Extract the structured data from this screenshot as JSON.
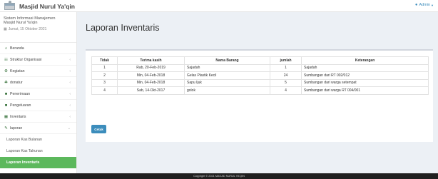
{
  "header": {
    "app_title": "Masjid Nurul Ya'qin",
    "user_label": "Admin",
    "logo_icon": "mosque-logo-icon"
  },
  "sidebar": {
    "system_name_line1": "Sistem Informasi Manajemen",
    "system_name_line2": "Masjid Nurul Ya'qin",
    "date": "Jumat, 15 Oktober 2021",
    "items": [
      {
        "label": "Beranda",
        "icon": "home-icon",
        "has_chevron": false
      },
      {
        "label": "Struktur Organisasi",
        "icon": "sitemap-icon",
        "has_chevron": true
      },
      {
        "label": "Kegiatan",
        "icon": "settings-icon",
        "has_chevron": true
      },
      {
        "label": "donatur",
        "icon": "donor-icon",
        "has_chevron": true
      },
      {
        "label": "Penerimaan",
        "icon": "income-folder-icon",
        "has_chevron": true
      },
      {
        "label": "Pengeluaran",
        "icon": "expense-folder-icon",
        "has_chevron": true
      },
      {
        "label": "Inventaris",
        "icon": "inventory-icon",
        "has_chevron": true
      },
      {
        "label": "laporan",
        "icon": "report-icon",
        "has_chevron": true
      }
    ],
    "submenu": [
      {
        "label": "Laporan Kas Bulanan"
      },
      {
        "label": "Laporan Kas Tahunan"
      },
      {
        "label": "Laporan Inventaris"
      }
    ]
  },
  "main": {
    "page_title": "Laporan Inventaris",
    "table": {
      "headers": [
        "Tidak",
        "Terima kasih",
        "Nama Barang",
        "jumlah",
        "Keterangan"
      ],
      "rows": [
        [
          "1",
          "Rab, 20-Feb-2019",
          "Sajadah",
          "1",
          "Sajadah"
        ],
        [
          "2",
          "Min, 04-Feb-2018",
          "Gelas Plastik Kecil",
          "24",
          "Sumbangan dari RT 002/012"
        ],
        [
          "3",
          "Min, 04-Feb-2018",
          "Sapu Ijuk",
          "5",
          "Sumbangan dari warga setempat"
        ],
        [
          "4",
          "Sab, 14-Okt-2017",
          "golok",
          "4",
          "Sumbangan dari warga RT 004/001"
        ]
      ]
    },
    "print_button": "Cetak"
  },
  "footer": {
    "copyright": "Copyright © 2021 MASJID NURUL YA'QIN"
  },
  "colors": {
    "accent_blue": "#3c8dbc",
    "active_green": "#5cb85c",
    "footer_bg": "#1f1f1f"
  }
}
